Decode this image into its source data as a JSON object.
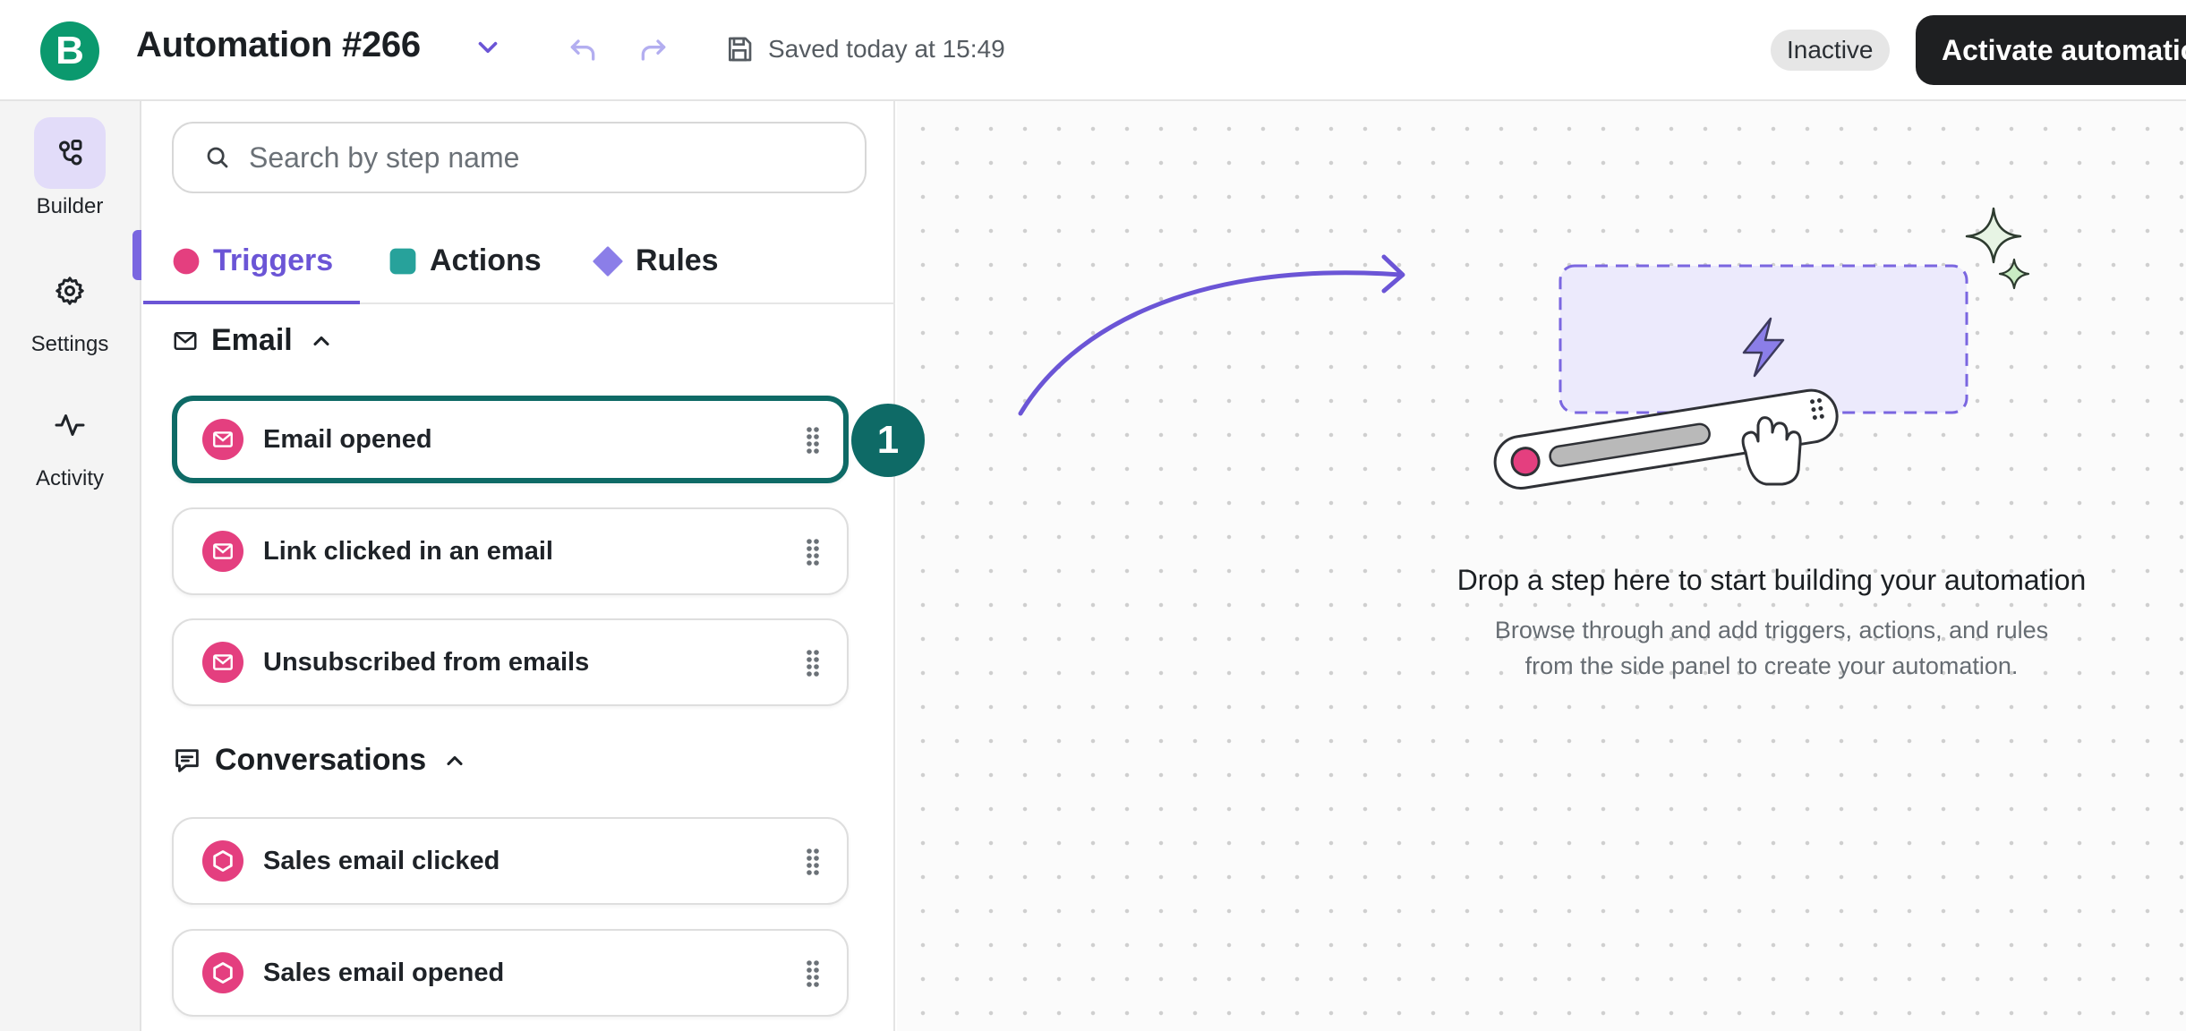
{
  "header": {
    "logo_letter": "B",
    "title": "Automation #266",
    "saved_text": "Saved today at 15:49",
    "status": "Inactive",
    "activate_label": "Activate automation"
  },
  "nav": {
    "items": [
      {
        "label": "Builder",
        "icon": "builder-icon",
        "active": true
      },
      {
        "label": "Settings",
        "icon": "gear-icon"
      },
      {
        "label": "Activity",
        "icon": "pulse-icon"
      }
    ]
  },
  "panel": {
    "search_placeholder": "Search by step name",
    "tabs": [
      {
        "label": "Triggers",
        "color": "#e43f7f",
        "active": true
      },
      {
        "label": "Actions",
        "color": "#27a29b"
      },
      {
        "label": "Rules",
        "color": "#8b7ee8"
      }
    ],
    "sections": [
      {
        "title": "Email",
        "icon": "mail-icon",
        "items": [
          {
            "label": "Email opened",
            "icon": "mail-icon",
            "selected": true
          },
          {
            "label": "Link clicked in an email",
            "icon": "mail-icon"
          },
          {
            "label": "Unsubscribed from emails",
            "icon": "mail-icon"
          }
        ]
      },
      {
        "title": "Conversations",
        "icon": "chat-icon",
        "items": [
          {
            "label": "Sales email clicked",
            "icon": "hexagon-icon"
          },
          {
            "label": "Sales email opened",
            "icon": "hexagon-icon"
          }
        ]
      }
    ]
  },
  "callout_number": "1",
  "canvas": {
    "empty_title": "Drop a step here to start building your automation",
    "empty_desc_line1": "Browse through and add triggers, actions, and rules",
    "empty_desc_line2": "from the side panel to create your automation."
  },
  "colors": {
    "brand": "#0b996e",
    "accent": "#6b55d6",
    "selected_border": "#0e6a66",
    "trigger_pink": "#e43f7f"
  }
}
